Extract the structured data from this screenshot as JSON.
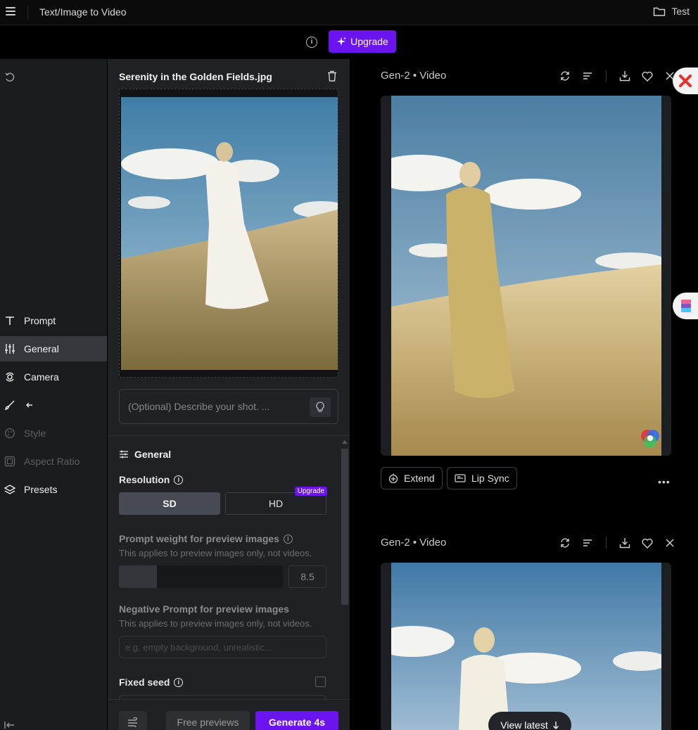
{
  "header": {
    "title": "Text/Image to Video",
    "project": "Test"
  },
  "upgrade": {
    "label": "Upgrade"
  },
  "nav": {
    "items": [
      {
        "label": "Prompt"
      },
      {
        "label": "General"
      },
      {
        "label": "Camera"
      },
      {
        "label": ""
      },
      {
        "label": "Style"
      },
      {
        "label": "Aspect Ratio"
      },
      {
        "label": "Presets"
      }
    ]
  },
  "panel": {
    "file_name": "Serenity in the Golden Fields.jpg",
    "describe_placeholder": "(Optional) Describe your shot. ...",
    "section_title": "General",
    "resolution_label": "Resolution",
    "sd": "SD",
    "hd": "HD",
    "hd_badge": "Upgrade",
    "prompt_weight_label": "Prompt weight for preview images",
    "prompt_weight_sub": "This applies to preview images only, not videos.",
    "prompt_weight_value": "8.5",
    "prompt_weight_fraction": 0.23,
    "neg_label": "Negative Prompt for preview images",
    "neg_sub": "This applies to preview images only, not videos.",
    "neg_placeholder": "e.g. empty background, unrealistic...",
    "seed_label": "Fixed seed",
    "free_previews": "Free previews",
    "generate": "Generate 4s"
  },
  "results": {
    "cards": [
      {
        "title": "Gen-2 • Video"
      },
      {
        "title": "Gen-2 • Video"
      }
    ],
    "extend": "Extend",
    "lip_sync": "Lip Sync",
    "view_latest": "View latest"
  },
  "colors": {
    "accent": "#6b14ef",
    "panel": "#202125",
    "nav": "#1b1c1f",
    "active_nav": "#35373d"
  }
}
